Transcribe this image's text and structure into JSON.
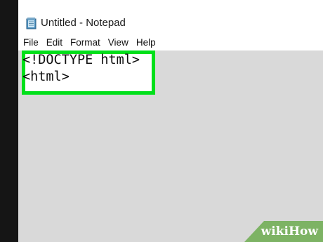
{
  "window": {
    "title": "Untitled - Notepad",
    "icon": "notepad-icon"
  },
  "menu": {
    "items": [
      {
        "label": "File"
      },
      {
        "label": "Edit"
      },
      {
        "label": "Format"
      },
      {
        "label": "View"
      },
      {
        "label": "Help"
      }
    ]
  },
  "editor": {
    "lines": [
      "<!DOCTYPE html>",
      "<html>"
    ],
    "highlight_color": "#00e01a"
  },
  "watermark": {
    "brand_wiki": "wiki",
    "brand_how": "How",
    "badge_color": "#7db364"
  }
}
